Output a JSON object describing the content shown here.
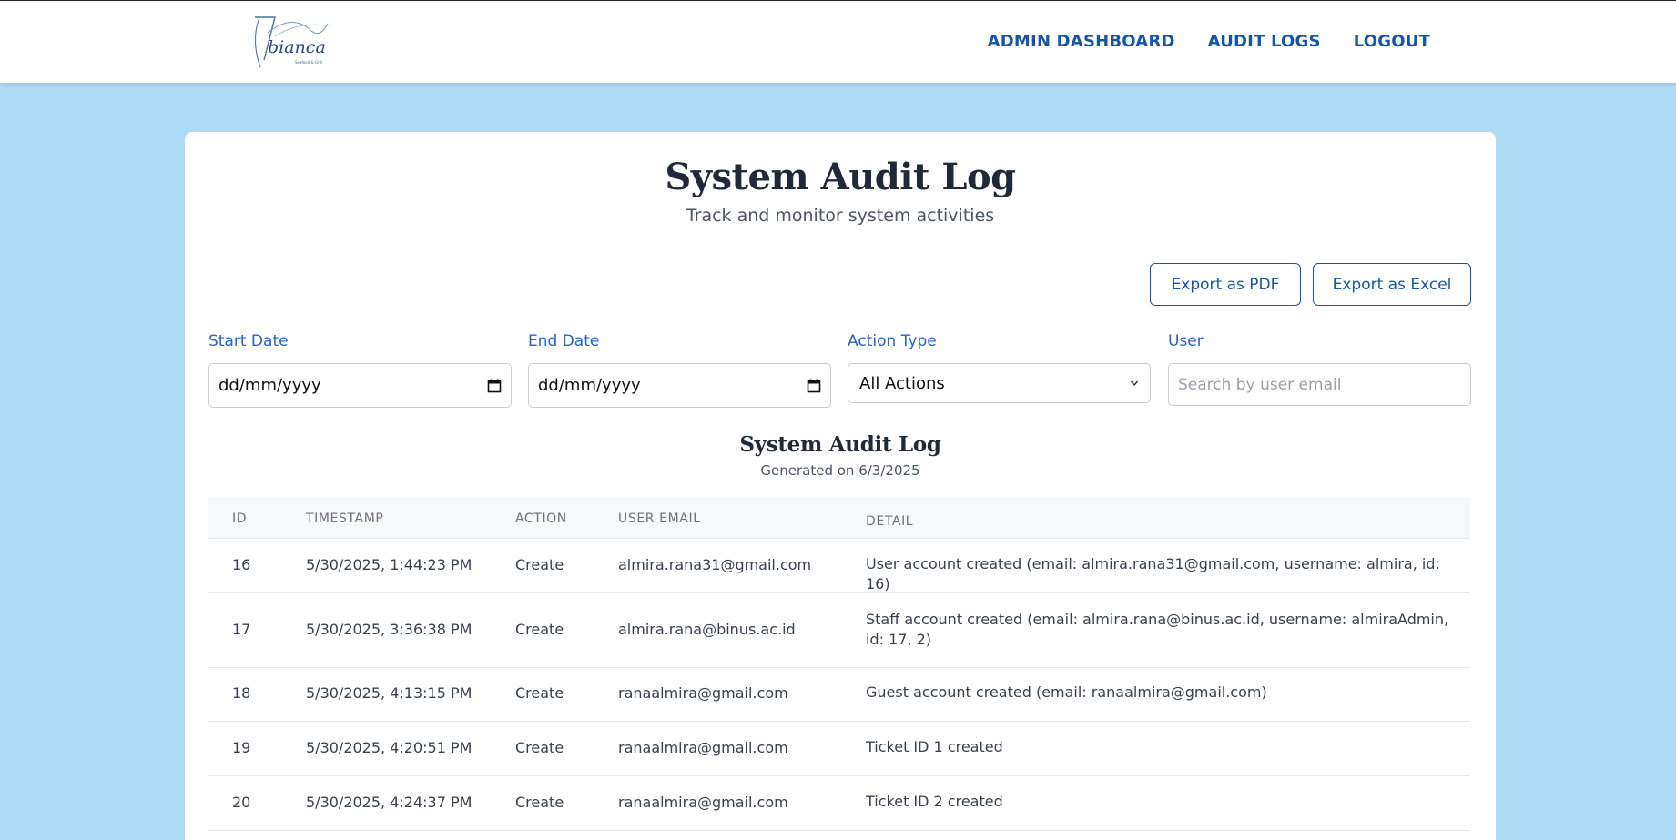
{
  "nav": {
    "logo": {
      "text": "bianca",
      "tagline": "Seafood & Grill"
    },
    "links": [
      {
        "label": "ADMIN DASHBOARD"
      },
      {
        "label": "AUDIT LOGS"
      },
      {
        "label": "LOGOUT"
      }
    ]
  },
  "header": {
    "title": "System Audit Log",
    "subtitle": "Track and monitor system activities"
  },
  "actions": {
    "export_pdf": "Export as PDF",
    "export_excel": "Export as Excel"
  },
  "filters": {
    "start_date": {
      "label": "Start Date",
      "value": "dd/mm/yyyy"
    },
    "end_date": {
      "label": "End Date",
      "value": "dd/mm/yyyy"
    },
    "action_type": {
      "label": "Action Type",
      "value": "All Actions"
    },
    "user": {
      "label": "User",
      "placeholder": "Search by user email"
    }
  },
  "report": {
    "title": "System Audit Log",
    "generated": "Generated on 6/3/2025"
  },
  "table": {
    "columns": [
      "ID",
      "TIMESTAMP",
      "ACTION",
      "USER EMAIL",
      "DETAIL"
    ],
    "rows": [
      {
        "id": "16",
        "timestamp": "5/30/2025, 1:44:23 PM",
        "action": "Create",
        "email": "almira.rana31@gmail.com",
        "detail": "User account created (email: almira.rana31@gmail.com, username: almira, id: 16)"
      },
      {
        "id": "17",
        "timestamp": "5/30/2025, 3:36:38 PM",
        "action": "Create",
        "email": "almira.rana@binus.ac.id",
        "detail": "Staff account created (email: almira.rana@binus.ac.id, username: almiraAdmin, id: 17, 2)"
      },
      {
        "id": "18",
        "timestamp": "5/30/2025, 4:13:15 PM",
        "action": "Create",
        "email": "ranaalmira@gmail.com",
        "detail": "Guest account created (email: ranaalmira@gmail.com)"
      },
      {
        "id": "19",
        "timestamp": "5/30/2025, 4:20:51 PM",
        "action": "Create",
        "email": "ranaalmira@gmail.com",
        "detail": "Ticket ID 1 created"
      },
      {
        "id": "20",
        "timestamp": "5/30/2025, 4:24:37 PM",
        "action": "Create",
        "email": "ranaalmira@gmail.com",
        "detail": "Ticket ID 2 created"
      }
    ]
  },
  "colors": {
    "background": "#addcf6",
    "accent": "#1656a8",
    "label": "#2563d0"
  }
}
